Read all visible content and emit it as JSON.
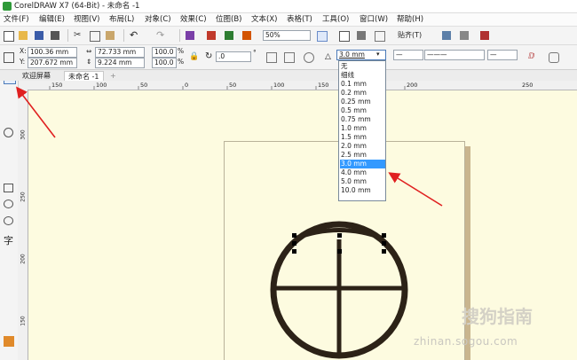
{
  "window": {
    "title": "CorelDRAW X7 (64-Bit) - 未命名 -1"
  },
  "menu": [
    "文件(F)",
    "编辑(E)",
    "视图(V)",
    "布局(L)",
    "对象(C)",
    "效果(C)",
    "位图(B)",
    "文本(X)",
    "表格(T)",
    "工具(O)",
    "窗口(W)",
    "帮助(H)"
  ],
  "toolbar": {
    "zoom": "50%",
    "snap_label": "贴齐(T)"
  },
  "property_bar": {
    "x": "100.36 mm",
    "y": "207.672 mm",
    "width": "72.733 mm",
    "height": "9.224 mm",
    "scale_x": "100.0",
    "scale_y": "100.0",
    "pct_x": "%",
    "pct_y": "%",
    "rotation": ".0",
    "degree": "°",
    "outline_width": "3.0 mm"
  },
  "tabs": [
    "欢迎屏幕",
    "未命名 -1",
    "+"
  ],
  "ruler": {
    "h_ticks": [
      "150",
      "100",
      "50",
      "0",
      "50",
      "100",
      "150",
      "200",
      "250"
    ],
    "v_ticks": [
      "300",
      "250",
      "200",
      "150"
    ]
  },
  "outline_dropdown": {
    "options": [
      "无",
      "细线",
      "0.1 mm",
      "0.2 mm",
      "0.25 mm",
      "0.5 mm",
      "0.75 mm",
      "1.0 mm",
      "1.5 mm",
      "2.0 mm",
      "2.5 mm",
      "3.0 mm",
      "4.0 mm",
      "5.0 mm",
      "10.0 mm"
    ],
    "selected_index": 11
  },
  "watermark": {
    "main": "搜狗指南",
    "sub": "zhinan.sogou.com"
  }
}
